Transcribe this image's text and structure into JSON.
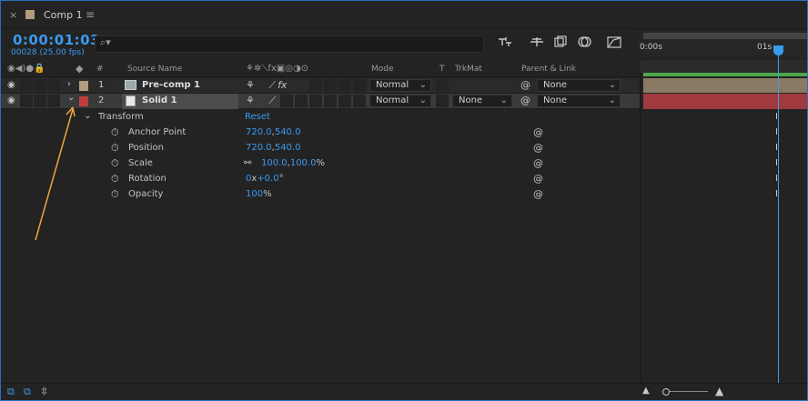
{
  "tab": {
    "close": "×",
    "title": "Comp 1",
    "menu": "≡"
  },
  "timecode": "0:00:01:03",
  "frames_fps": "00028 (25.00 fps)",
  "search": {
    "placeholder": ""
  },
  "header": {
    "source_name": "Source Name",
    "num": "#",
    "mode": "Mode",
    "t": "T",
    "trkmat": "TrkMat",
    "parent_link": "Parent & Link"
  },
  "layers": [
    {
      "index": "1",
      "name": "Pre-comp 1",
      "mode": "Normal",
      "trkmat": "",
      "parent": "None",
      "color": "#b39c7d"
    },
    {
      "index": "2",
      "name": "Solid 1",
      "mode": "Normal",
      "trkmat": "None",
      "parent": "None",
      "color": "#c03d3d"
    }
  ],
  "transform": {
    "label": "Transform",
    "reset": "Reset",
    "props": [
      {
        "name": "Anchor Point",
        "v1": "720.0",
        "sep": ",",
        "v2": "540.0",
        "suffix": ""
      },
      {
        "name": "Position",
        "v1": "720.0",
        "sep": ",",
        "v2": "540.0",
        "suffix": ""
      },
      {
        "name": "Scale",
        "v1": "100.0",
        "sep": ",",
        "v2": "100.0",
        "suffix": "%"
      },
      {
        "name": "Rotation",
        "v1": "0",
        "sep": "x",
        "v2": "+0.0",
        "suffix": "°"
      },
      {
        "name": "Opacity",
        "v1": "100",
        "sep": "",
        "v2": "",
        "suffix": "%"
      }
    ]
  },
  "ruler": {
    "t0": "0:00s",
    "t1": "01s"
  },
  "colors": {
    "accent": "#3a9bf0",
    "panel": "#232323",
    "row": "#2a2a2a"
  }
}
